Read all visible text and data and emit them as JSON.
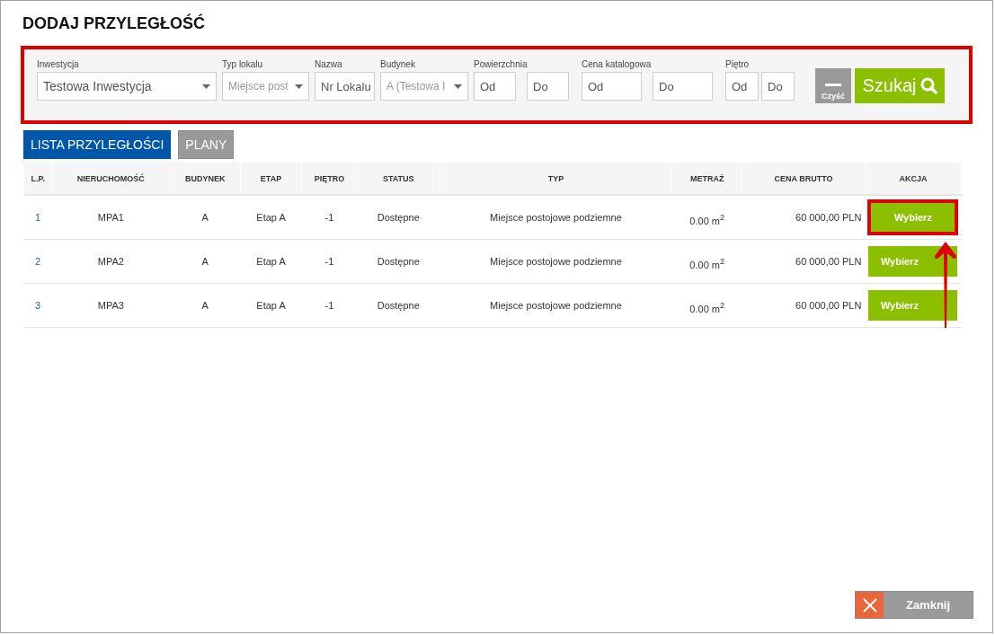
{
  "title": "DODAJ PRZYLEGŁOŚĆ",
  "filters": {
    "highlighted": true,
    "fields": [
      {
        "kind": "select",
        "label": "Inwestycja",
        "value": "Testowa Inwestycja"
      },
      {
        "kind": "select",
        "label": "Typ lokalu",
        "placeholder": "Miejsce post"
      },
      {
        "kind": "input",
        "label": "Nazwa",
        "placeholder": "Nr Lokalu"
      },
      {
        "kind": "select",
        "label": "Budynek",
        "placeholder": "A (Testowa I"
      },
      {
        "kind": "range",
        "label": "Powierzchnia",
        "inputs": [
          {
            "placeholder": "Od"
          },
          {
            "placeholder": "Do"
          }
        ]
      },
      {
        "kind": "range",
        "label": "Cena katalogowa",
        "inputs": [
          {
            "placeholder": "Od"
          },
          {
            "placeholder": "Do"
          }
        ]
      },
      {
        "kind": "range",
        "label": "Piętro",
        "inputs": [
          {
            "placeholder": "Od"
          },
          {
            "placeholder": "Do"
          }
        ]
      }
    ],
    "clear_label": "Czyść",
    "search_label": "Szukaj"
  },
  "tabs": [
    {
      "label": "LISTA PRZYLEGŁOŚCI",
      "selected": true
    },
    {
      "label": "PLANY",
      "selected": false
    }
  ],
  "table": {
    "columns": [
      "L.P.",
      "NIERUCHOMOŚĆ",
      "BUDYNEK",
      "ETAP",
      "PIĘTRO",
      "STATUS",
      "TYP",
      "METRAŻ",
      "CENA BRUTTO",
      "AKCJA"
    ],
    "rows": [
      {
        "cells": [
          "1",
          "MPA1",
          "A",
          "Etap A",
          "-1",
          "Dostępne",
          "Miejsce postojowe podziemne",
          "0.00 m$^{2}$",
          "60 000,00 PLN"
        ],
        "action": "Wybierz",
        "highlighted": true
      },
      {
        "cells": [
          "2",
          "MPA2",
          "A",
          "Etap A",
          "-1",
          "Dostępne",
          "Miejsce postojowe podziemne",
          "0.00 m$^{2}$",
          "60 000,00 PLN"
        ],
        "action": "Wybierz",
        "highlighted": false
      },
      {
        "cells": [
          "3",
          "MPA3",
          "A",
          "Etap A",
          "-1",
          "Dostępne",
          "Miejsce postojowe podziemne",
          "0.00 m$^{2}$",
          "60 000,00 PLN"
        ],
        "action": "Wybierz",
        "highlighted": false
      }
    ]
  },
  "annotation_arrow": true,
  "close_label": "Zamknij"
}
